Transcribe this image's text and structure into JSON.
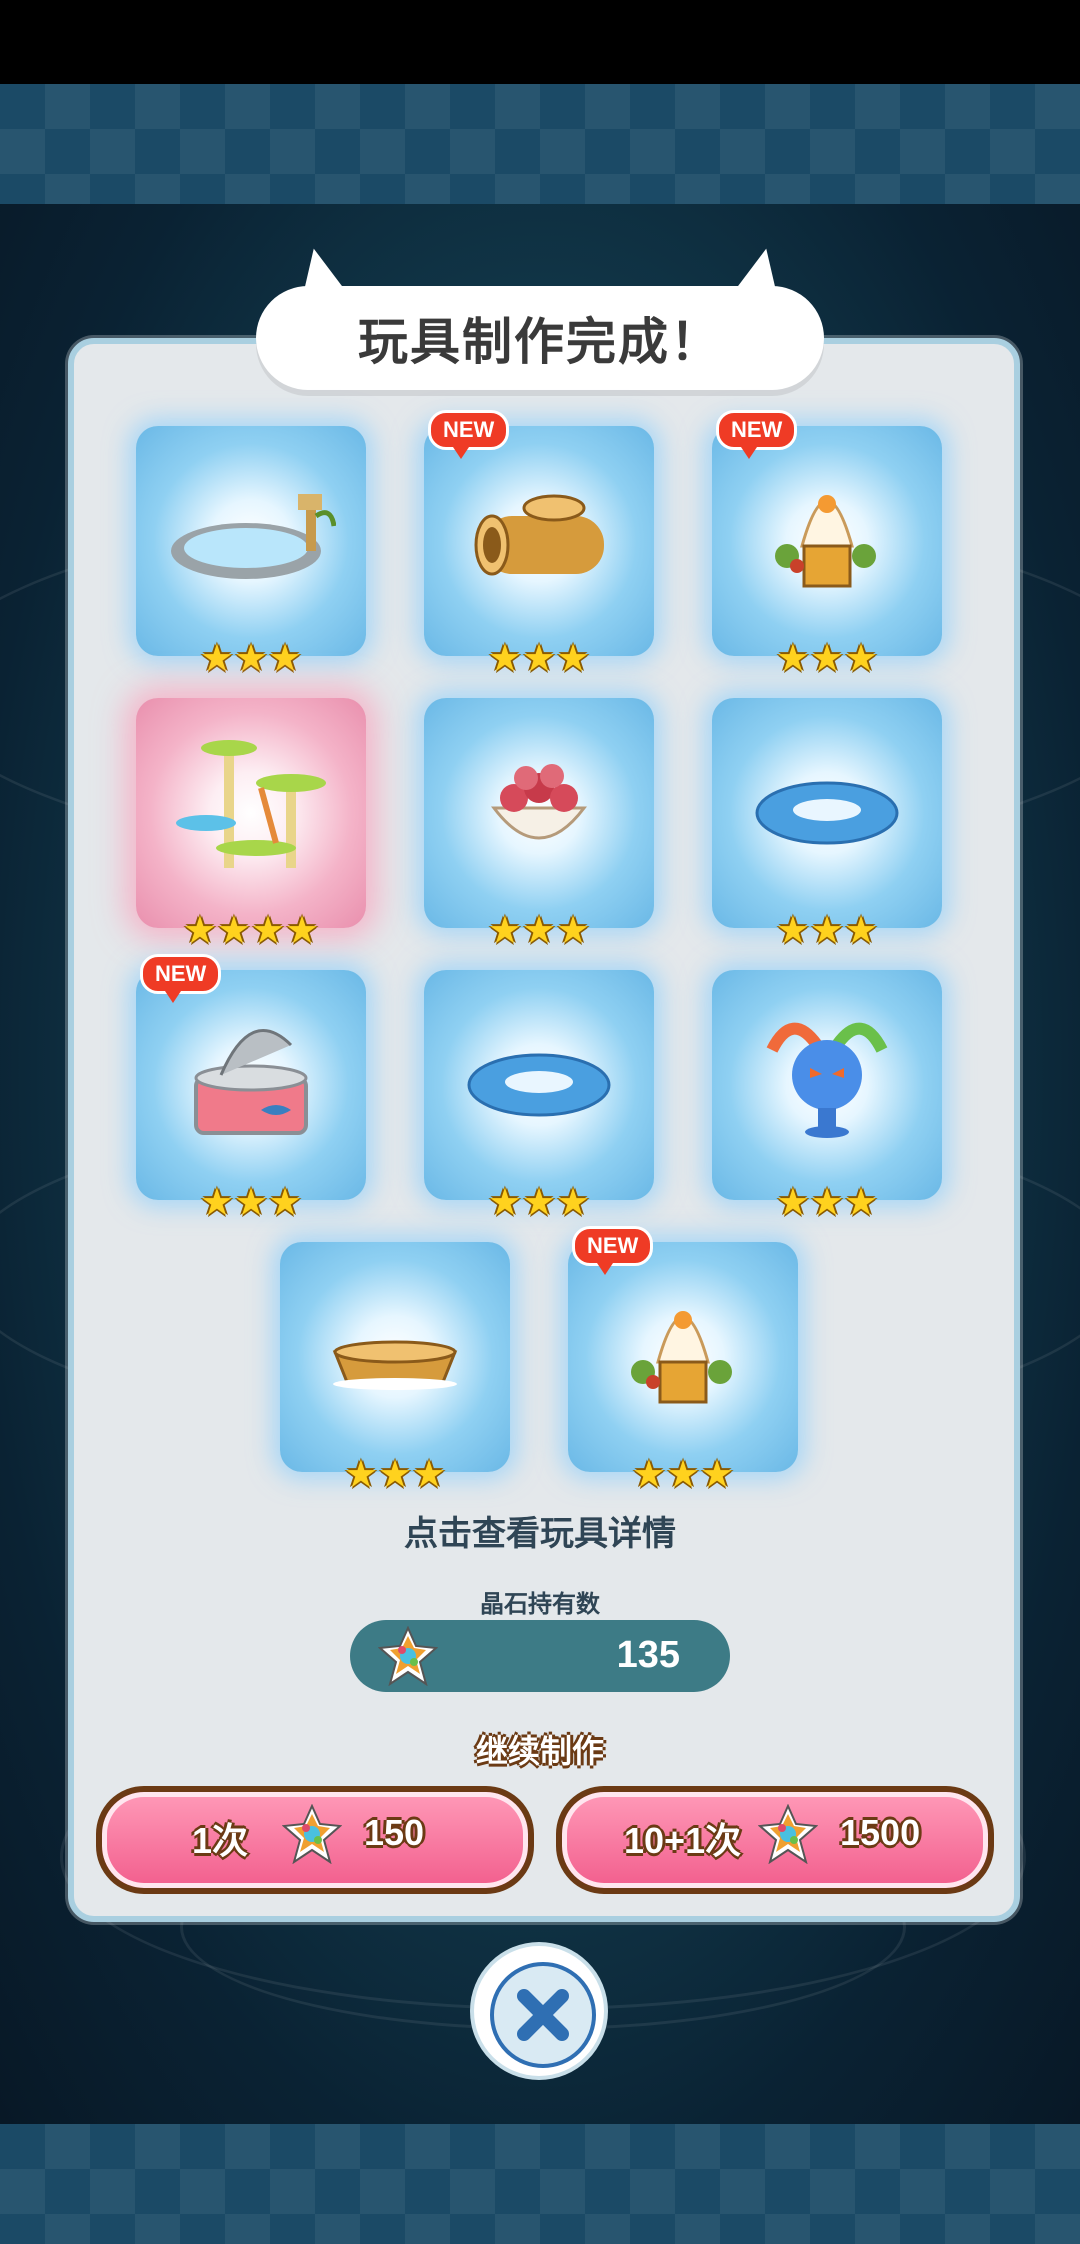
{
  "dialog": {
    "title": "玩具制作完成！"
  },
  "badge_text": "NEW",
  "toys": [
    {
      "name": "pond-toy",
      "stars": "★★★",
      "new": false,
      "glow": "blue"
    },
    {
      "name": "log-tunnel-toy",
      "stars": "★★★",
      "new": true,
      "glow": "blue"
    },
    {
      "name": "chestnut-cat-house-toy",
      "stars": "★★★",
      "new": true,
      "glow": "blue"
    },
    {
      "name": "cat-tower-toy",
      "stars": "★★★★",
      "new": false,
      "glow": "pink"
    },
    {
      "name": "rose-basket-toy",
      "stars": "★★★",
      "new": false,
      "glow": "blue"
    },
    {
      "name": "swim-ring-toy",
      "stars": "★★★",
      "new": false,
      "glow": "blue"
    },
    {
      "name": "tuna-can-toy",
      "stars": "★★★",
      "new": true,
      "glow": "blue"
    },
    {
      "name": "swim-ring-toy-2",
      "stars": "★★★",
      "new": false,
      "glow": "blue"
    },
    {
      "name": "monster-statue-toy",
      "stars": "★★★",
      "new": false,
      "glow": "blue"
    },
    {
      "name": "wooden-tub-toy",
      "stars": "★★★",
      "new": false,
      "glow": "blue"
    },
    {
      "name": "chestnut-cat-house-toy-2",
      "stars": "★★★",
      "new": true,
      "glow": "blue"
    }
  ],
  "hint": "点击查看玩具详情",
  "gems": {
    "label": "晶石持有数",
    "value": "135"
  },
  "continue_label": "继续制作",
  "buttons": {
    "single": {
      "label": "1次",
      "cost": "150"
    },
    "multi": {
      "label": "10+1次",
      "cost": "1500"
    }
  },
  "colors": {
    "panel": "#e4e8eb",
    "button": "#f25e8d",
    "gem_bar": "#3d7b86",
    "badge": "#ef3b25"
  }
}
